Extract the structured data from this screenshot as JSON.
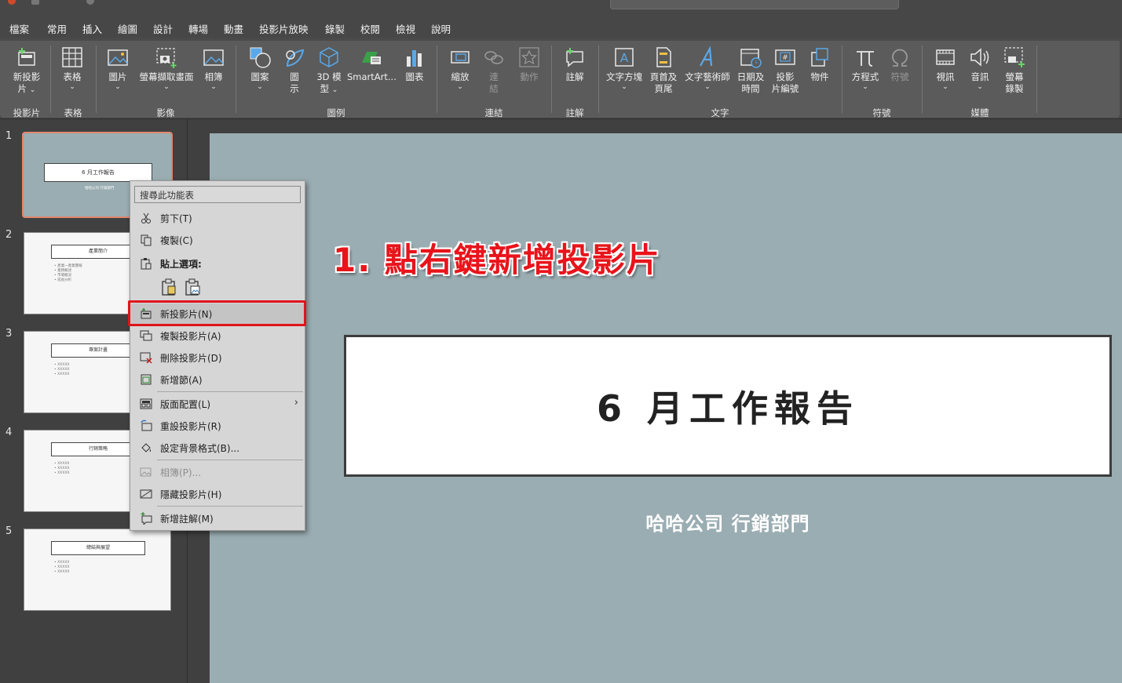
{
  "tabs": [
    "檔案",
    "常用",
    "插入",
    "繪圖",
    "設計",
    "轉場",
    "動畫",
    "投影片放映",
    "錄製",
    "校閱",
    "檢視",
    "說明"
  ],
  "active_tab": "插入",
  "ribbon": {
    "new_slide": "新投影",
    "new_slide_2": "片",
    "table": "表格",
    "pictures": "圖片",
    "screenshot": "螢幕擷取畫面",
    "album": "相簿",
    "shapes": "圖案",
    "icons": "圖",
    "icons_2": "示",
    "models": "3D 模",
    "models_2": "型",
    "smartart": "SmartArt...",
    "chart": "圖表",
    "zoom": "縮放",
    "link": "連",
    "link_2": "結",
    "action": "動作",
    "comment": "註解",
    "textbox": "文字方塊",
    "header": "頁首及",
    "header_2": "頁尾",
    "wordart": "文字藝術師",
    "datetime": "日期及",
    "datetime_2": "時間",
    "slidenum": "投影",
    "slidenum_2": "片編號",
    "object": "物件",
    "equation": "方程式",
    "symbol": "符號",
    "video": "視訊",
    "audio": "音訊",
    "screen_rec": "螢幕",
    "screen_rec_2": "錄製",
    "groups": {
      "slides": "投影片",
      "tables": "表格",
      "images": "影像",
      "illustrations": "圖例",
      "links": "連結",
      "comments": "註解",
      "text": "文字",
      "symbols": "符號",
      "media": "媒體"
    }
  },
  "thumbnails": [
    {
      "num": "1",
      "title": "6 月工作報告",
      "lines": [
        "哈哈公司 行銷部門"
      ]
    },
    {
      "num": "2",
      "title": "產業簡介",
      "lines": [
        "• 產業一產業簡報",
        "• 業務概述",
        "• 市場概況",
        "• 成長分析"
      ]
    },
    {
      "num": "3",
      "title": "專案計畫",
      "lines": [
        "• XXXXX",
        "• XXXXX",
        "• XXXXX"
      ]
    },
    {
      "num": "4",
      "title": "行銷策略",
      "lines": [
        "• XXXXX",
        "• XXXXX",
        "• XXXXX"
      ]
    },
    {
      "num": "5",
      "title": "總結與展望",
      "lines": [
        "• XXXXX",
        "• XXXXX",
        "• XXXXX"
      ]
    }
  ],
  "slide": {
    "title": "6 月工作報告",
    "subtitle": "哈哈公司 行銷部門"
  },
  "annotation": "1. 點右鍵新增投影片",
  "context_menu": {
    "search_placeholder": "搜尋此功能表",
    "cut": "剪下(T)",
    "copy": "複製(C)",
    "paste_options": "貼上選項:",
    "new_slide": "新投影片(N)",
    "duplicate": "複製投影片(A)",
    "delete": "刪除投影片(D)",
    "add_section": "新增節(A)",
    "layout": "版面配置(L)",
    "reset": "重設投影片(R)",
    "format_bg": "設定背景格式(B)...",
    "photo_album": "相簿(P)...",
    "hide_slide": "隱藏投影片(H)",
    "new_comment": "新增註解(M)"
  },
  "colors": {
    "accent": "#e0705a",
    "highlight_box": "#e0141c",
    "slide_bg": "#9aadb2"
  }
}
